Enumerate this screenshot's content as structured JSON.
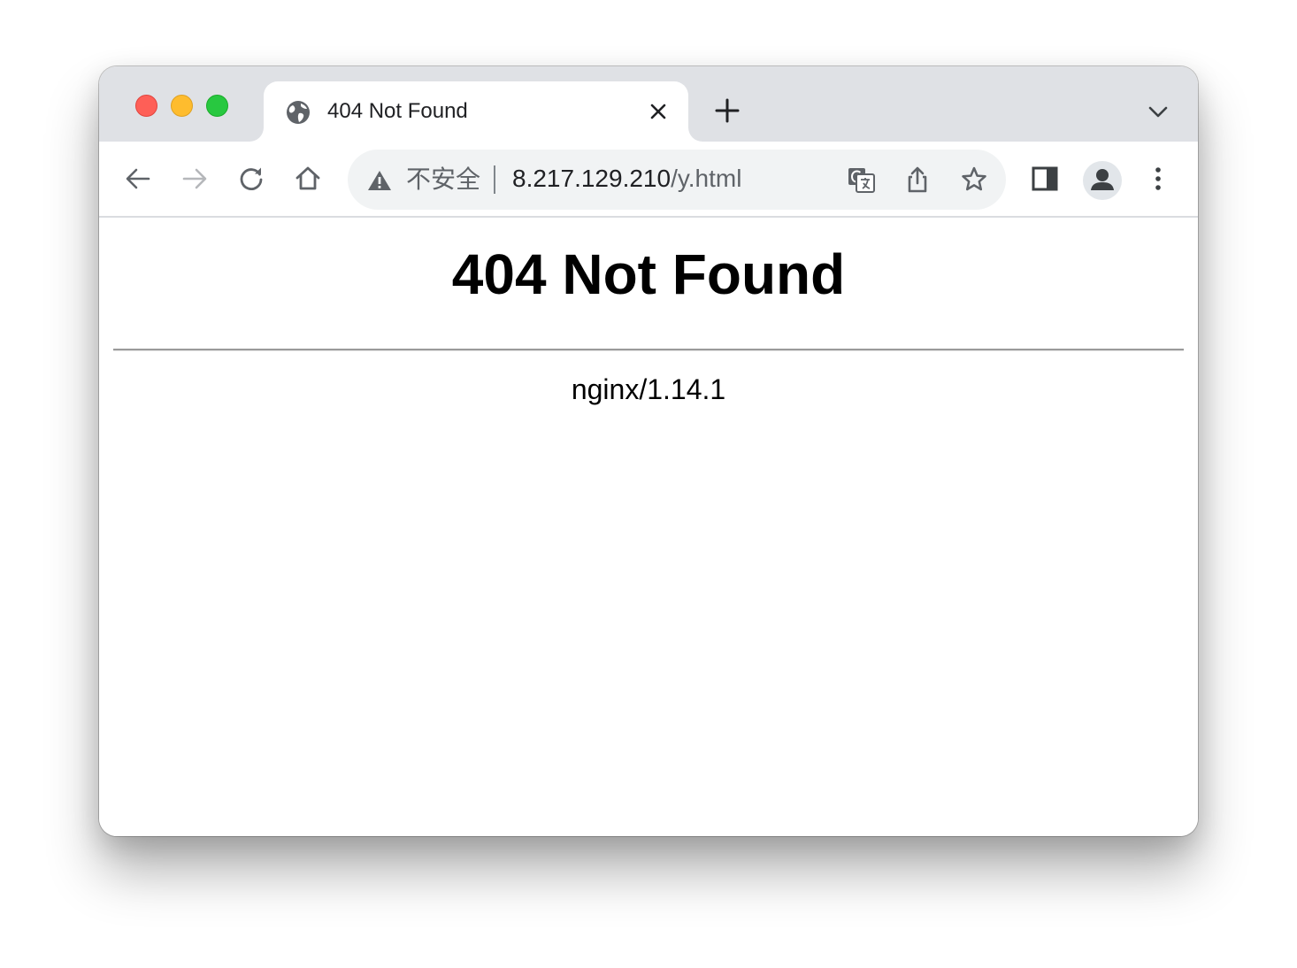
{
  "tab": {
    "title": "404 Not Found",
    "favicon": "globe-icon"
  },
  "omnibox": {
    "security_label": "不安全",
    "url_host": "8.217.129.210",
    "url_path": "/y.html"
  },
  "page": {
    "heading": "404 Not Found",
    "server": "nginx/1.14.1"
  },
  "colors": {
    "tabstrip_bg": "#dfe1e5",
    "omnibox_bg": "#f1f3f4",
    "icon_color": "#5f6368",
    "close_light": "#fe5f57",
    "minimize_light": "#febc2e",
    "maximize_light": "#28c840"
  }
}
